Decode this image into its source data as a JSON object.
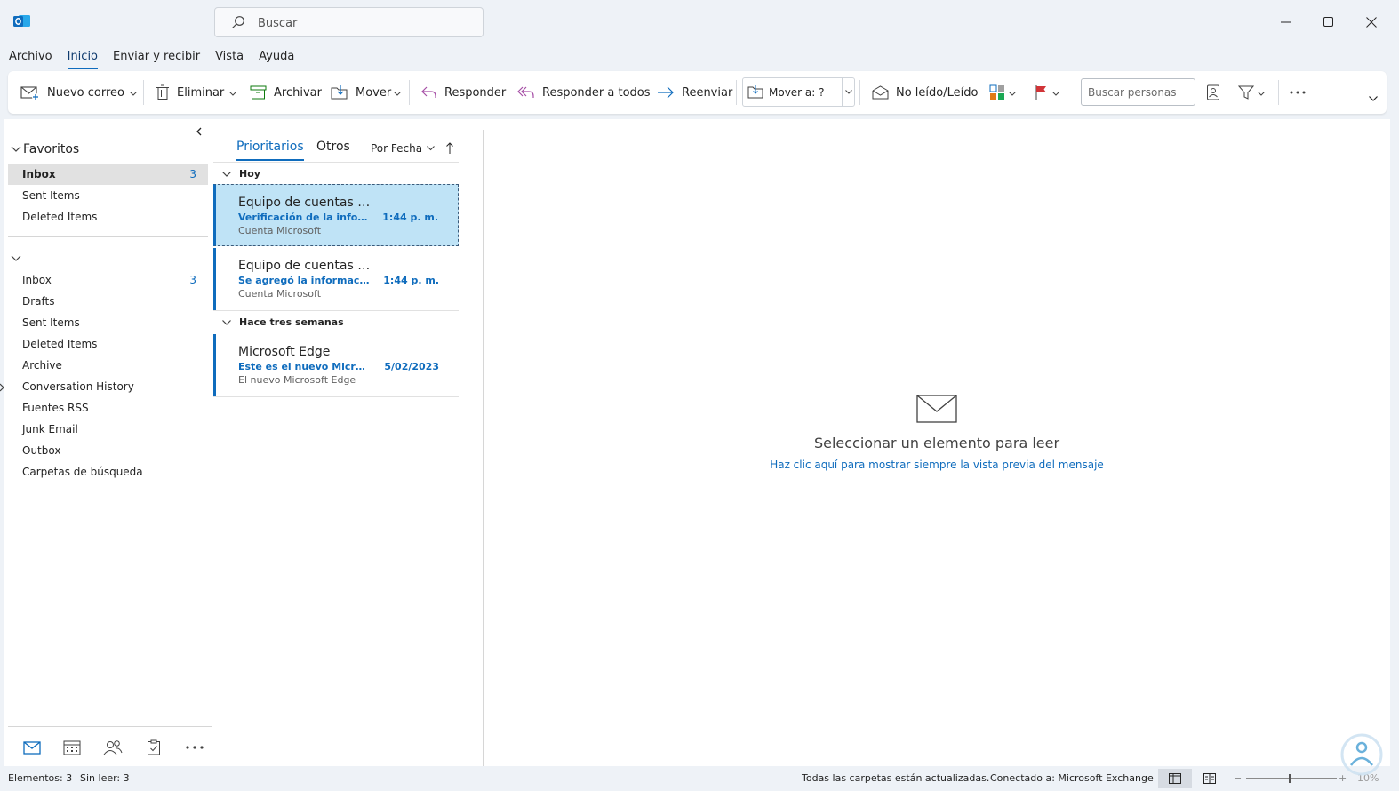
{
  "colors": {
    "accent": "#0f6cbd",
    "selected_row": "#bfe3f6",
    "chrome": "#eef2f7"
  },
  "search": {
    "placeholder": "Buscar"
  },
  "menu": {
    "items": [
      "Archivo",
      "Inicio",
      "Enviar y recibir",
      "Vista",
      "Ayuda"
    ],
    "active": "Inicio"
  },
  "ribbon": {
    "new_mail": "Nuevo correo",
    "delete": "Eliminar",
    "archive": "Archivar",
    "move": "Mover",
    "reply": "Responder",
    "reply_all": "Responder a todos",
    "forward": "Reenviar",
    "move_to": "Mover a: ?",
    "unread_read": "No leído/Leído",
    "people_search_placeholder": "Buscar personas"
  },
  "folders": {
    "favorites_label": "Favoritos",
    "favorites": [
      {
        "label": "Inbox",
        "count": "3",
        "selected": true
      },
      {
        "label": "Sent Items",
        "count": ""
      },
      {
        "label": "Deleted Items",
        "count": ""
      }
    ],
    "account": [
      {
        "label": "Inbox",
        "count": "3"
      },
      {
        "label": "Drafts",
        "count": ""
      },
      {
        "label": "Sent Items",
        "count": ""
      },
      {
        "label": "Deleted Items",
        "count": ""
      },
      {
        "label": "Archive",
        "count": ""
      },
      {
        "label": "Conversation History",
        "count": "",
        "expandable": true
      },
      {
        "label": "Fuentes RSS",
        "count": ""
      },
      {
        "label": "Junk Email",
        "count": ""
      },
      {
        "label": "Outbox",
        "count": ""
      },
      {
        "label": "Carpetas de búsqueda",
        "count": ""
      }
    ]
  },
  "nav": {
    "icons": [
      "mail-icon",
      "calendar-icon",
      "people-icon",
      "tasks-icon",
      "more-icon"
    ]
  },
  "list": {
    "tabs": [
      "Prioritarios",
      "Otros"
    ],
    "sort_label": "Por Fecha",
    "groups": [
      {
        "label": "Hoy"
      },
      {
        "label": "Hace tres semanas"
      }
    ],
    "messages": [
      {
        "sender": "Equipo de cuentas Microsoft",
        "subject": "Verificación de la información de seguridad",
        "time": "1:44 p. m.",
        "preview": "Cuenta Microsoft",
        "selected": true
      },
      {
        "sender": "Equipo de cuentas Microsoft",
        "subject": "Se agregó la información de seguridad",
        "time": "1:44 p. m.",
        "preview": "Cuenta Microsoft"
      },
      {
        "sender": "Microsoft Edge",
        "subject": "Este es el nuevo Microsoft Edge",
        "time": "5/02/2023",
        "preview": "El nuevo Microsoft Edge"
      }
    ]
  },
  "reading": {
    "title": "Seleccionar un elemento para leer",
    "link": "Haz clic aquí para mostrar siempre la vista previa del mensaje"
  },
  "status": {
    "items": "Elementos: 3",
    "unread": "Sin leer: 3",
    "folders_updated": "Todas las carpetas están actualizadas.",
    "connected": "Conectado a: Microsoft Exchange",
    "zoom": "10%"
  }
}
